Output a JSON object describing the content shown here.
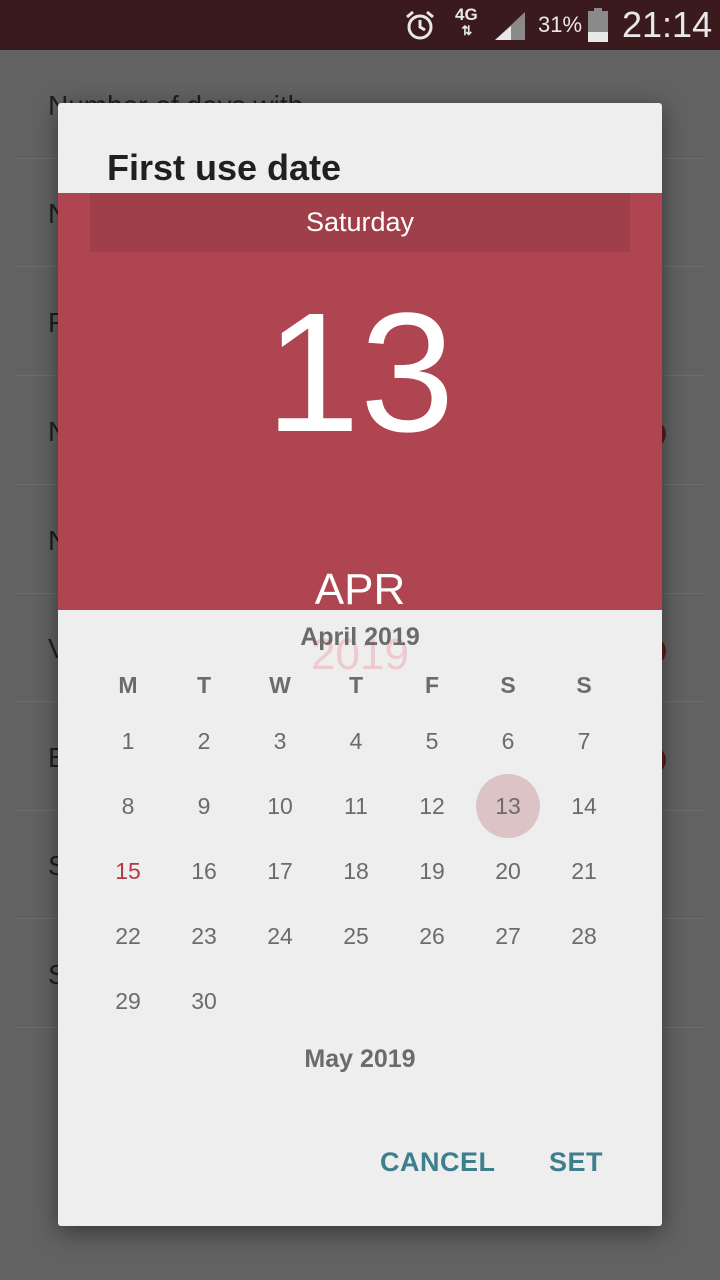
{
  "status_bar": {
    "network": "4G",
    "battery": "31%",
    "time": "21:14",
    "icons": [
      "alarm-icon",
      "signal-icon",
      "battery-icon"
    ]
  },
  "background_list": {
    "rows": [
      "Number of days with",
      "N",
      "F",
      "N",
      "N",
      "V",
      "E",
      "S",
      "S"
    ]
  },
  "dialog": {
    "title": "First use date",
    "header": {
      "day_of_week": "Saturday",
      "day": "13",
      "month": "APR",
      "year": "2019"
    },
    "calendar": {
      "month_title": "April 2019",
      "weekdays": [
        "M",
        "T",
        "W",
        "T",
        "F",
        "S",
        "S"
      ],
      "days": [
        "1",
        "2",
        "3",
        "4",
        "5",
        "6",
        "7",
        "8",
        "9",
        "10",
        "11",
        "12",
        "13",
        "14",
        "15",
        "16",
        "17",
        "18",
        "19",
        "20",
        "21",
        "22",
        "23",
        "24",
        "25",
        "26",
        "27",
        "28",
        "29",
        "30"
      ],
      "selected_day": "13",
      "today": "15",
      "next_month_title": "May 2019"
    },
    "buttons": {
      "cancel": "CANCEL",
      "set": "SET"
    }
  },
  "colors": {
    "accent": "#ae4550",
    "button": "#3d7f8c",
    "today": "#b23a48",
    "selected_bg": "#dcc4c6"
  }
}
